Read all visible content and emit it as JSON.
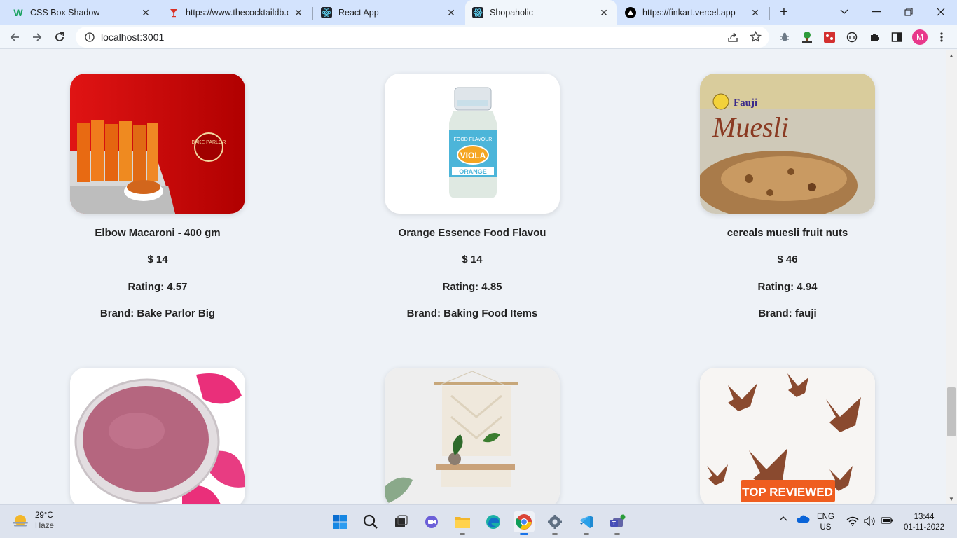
{
  "tabs": [
    {
      "title": "CSS Box Shadow",
      "icon": "webflow-w-icon"
    },
    {
      "title": "https://www.thecocktaildb.co",
      "icon": "cocktail-icon"
    },
    {
      "title": "React App",
      "icon": "react-icon"
    },
    {
      "title": "Shopaholic",
      "icon": "react-icon",
      "active": true
    },
    {
      "title": "https://finkart.vercel.app",
      "icon": "vercel-triangle-icon"
    }
  ],
  "address": {
    "url": "localhost:3001"
  },
  "profile": {
    "initial": "M"
  },
  "products": [
    {
      "name": "Elbow Macaroni - 400 gm",
      "price": "$ 14",
      "rating": "Rating: 4.57",
      "brand": "Brand: Bake Parlor Big",
      "image": "macaroni-pack-image",
      "image_text": "BAKE PARLOR"
    },
    {
      "name": "Orange Essence Food Flavou",
      "price": "$ 14",
      "rating": "Rating: 4.85",
      "brand": "Brand: Baking Food Items",
      "image": "flavour-bottle-image",
      "image_text": [
        "FOOD FLAVOUR",
        "VIOLA",
        "ORANGE"
      ]
    },
    {
      "name": "cereals muesli fruit nuts",
      "price": "$ 46",
      "rating": "Rating: 4.94",
      "brand": "Brand: fauji",
      "image": "muesli-box-image",
      "image_text": [
        "Fauji",
        "Muesli"
      ]
    },
    {
      "name": "",
      "price": "",
      "rating": "",
      "brand": "",
      "image": "rose-powder-image"
    },
    {
      "name": "",
      "price": "",
      "rating": "",
      "brand": "",
      "image": "macrame-shelf-image"
    },
    {
      "name": "",
      "price": "",
      "rating": "",
      "brand": "",
      "image": "wooden-birds-image",
      "image_text": "TOP REVIEWED"
    }
  ],
  "taskbar": {
    "weather": {
      "temp": "29°C",
      "condition": "Haze"
    },
    "lang": {
      "line1": "ENG",
      "line2": "US"
    },
    "clock": {
      "time": "13:44",
      "date": "01-11-2022"
    }
  },
  "colors": {
    "page_bg": "#eef2f7",
    "tab_strip": "#d3e3fd",
    "avatar": "#e8388b"
  }
}
